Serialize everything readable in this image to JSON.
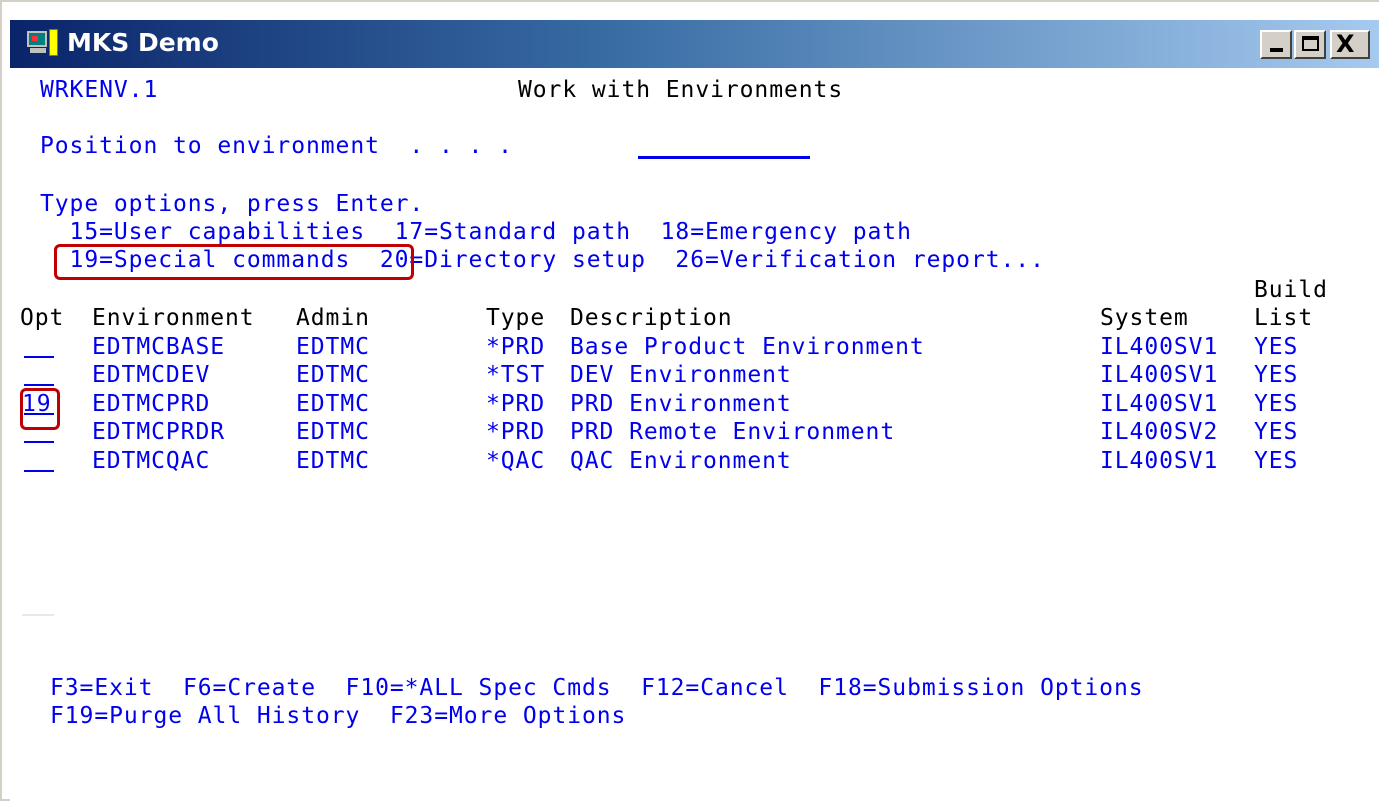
{
  "window": {
    "title": "MKS Demo",
    "controls": {
      "minimize": "_",
      "maximize": "□",
      "close": "X"
    }
  },
  "screen": {
    "program_id": "WRKENV.1",
    "heading": "Work with Environments",
    "position_label": "Position to environment  . . . .",
    "position_value": "",
    "instructions": "Type options, press Enter.",
    "options_line1": "  15=User capabilities  17=Standard path  18=Emergency path",
    "options_line2": "  19=Special commands  20=Directory setup  26=Verification report...",
    "column_headers": {
      "build": "Build",
      "opt": "Opt",
      "environment": "Environment",
      "admin": "Admin",
      "type": "Type",
      "description": "Description",
      "system": "System",
      "list": "List"
    },
    "rows": [
      {
        "opt": "",
        "environment": "EDTMCBASE",
        "admin": "EDTMC",
        "type": "*PRD",
        "description": "Base Product Environment",
        "system": "IL400SV1",
        "build_list": "YES"
      },
      {
        "opt": "",
        "environment": "EDTMCDEV",
        "admin": "EDTMC",
        "type": "*TST",
        "description": "DEV Environment",
        "system": "IL400SV1",
        "build_list": "YES"
      },
      {
        "opt": "19",
        "environment": "EDTMCPRD",
        "admin": "EDTMC",
        "type": "*PRD",
        "description": "PRD Environment",
        "system": "IL400SV1",
        "build_list": "YES"
      },
      {
        "opt": "",
        "environment": "EDTMCPRDR",
        "admin": "EDTMC",
        "type": "*PRD",
        "description": "PRD Remote Environment",
        "system": "IL400SV2",
        "build_list": "YES"
      },
      {
        "opt": "",
        "environment": "EDTMCQAC",
        "admin": "EDTMC",
        "type": "*QAC",
        "description": "QAC Environment",
        "system": "IL400SV1",
        "build_list": "YES"
      }
    ],
    "function_keys_line1": "F3=Exit  F6=Create  F10=*ALL Spec Cmds  F12=Cancel  F18=Submission Options",
    "function_keys_line2": "F19=Purge All History  F23=More Options"
  },
  "colors": {
    "field_text": "#0000ee",
    "label_text": "#000000",
    "highlight": "#c00000",
    "title_gradient_start": "#0a246a",
    "title_gradient_end": "#a6caf0"
  },
  "icons": [
    "app-icon",
    "minimize-icon",
    "maximize-icon",
    "close-icon"
  ]
}
